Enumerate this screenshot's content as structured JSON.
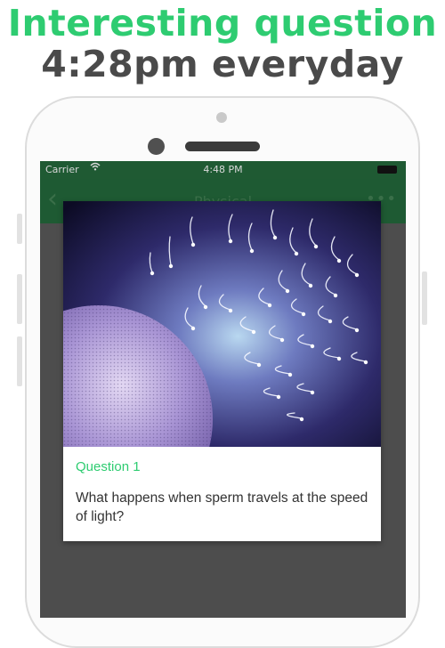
{
  "headline": {
    "line1": "Interesting question",
    "line2": "4:28pm everyday"
  },
  "status_bar": {
    "carrier": "Carrier",
    "time": "4:48 PM",
    "wifi_icon": "wifi-icon",
    "battery_icon": "battery-icon"
  },
  "nav": {
    "back_icon": "chevron-left-icon",
    "title": "Physical",
    "more_icon": "more-dots-icon"
  },
  "card": {
    "image_icon": "sperm-egg-illustration",
    "label": "Question 1",
    "question": "What happens when sperm travels at the speed of light?"
  },
  "colors": {
    "accent_green": "#2ecc71",
    "headline_gray": "#4a4a4a",
    "navbar_dark_green": "#1e5a33",
    "overlay_gray": "#4d4d4d"
  }
}
